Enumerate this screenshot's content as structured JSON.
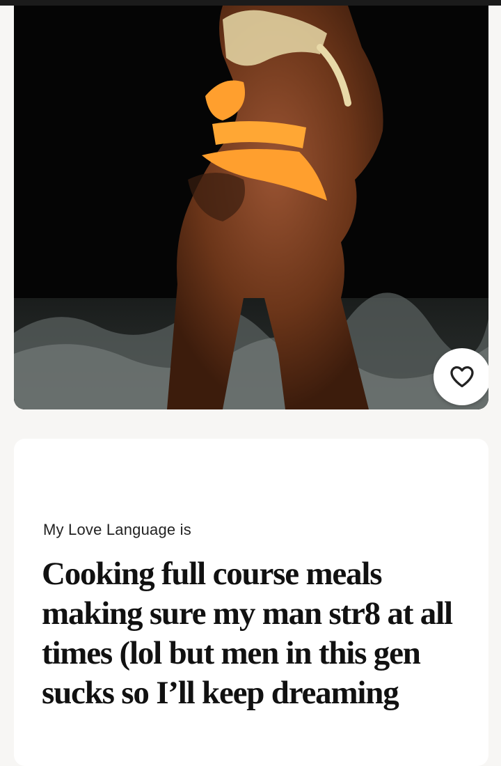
{
  "photo": {
    "image_desc": "woman-in-orange-swimsuit-at-night-beach",
    "like_icon": "heart-icon"
  },
  "prompt": {
    "label": "My Love Language is",
    "answer": "Cooking full course meals making sure my man str8 at all times (lol but men in this gen sucks so I’ll keep dreaming"
  },
  "colors": {
    "background": "#f7f6f4",
    "card": "#ffffff",
    "text": "#111111"
  }
}
